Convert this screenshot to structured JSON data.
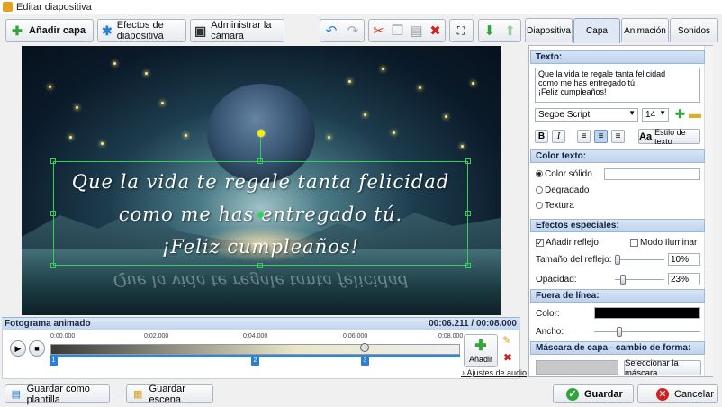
{
  "window": {
    "title": "Editar diapositiva"
  },
  "toolbar": {
    "add_layer": "Añadir capa",
    "slide_effects": "Efectos de diapositiva",
    "manage_camera": "Administrar la cámara"
  },
  "canvas": {
    "caption_lines": [
      "Que la vida te regale tanta felicidad",
      "como me has entregado tú.",
      "¡Feliz cumpleaños!"
    ],
    "reflection": "Que la vida te regale tanta felicidad"
  },
  "timeline": {
    "title": "Fotograma animado",
    "time_display": "00:06.211 / 00:08.000",
    "ticks": [
      "0:00.000",
      "0:02.000",
      "0:04.000",
      "0:06.000",
      "0:08.000"
    ],
    "markers": [
      "1",
      "2",
      "3"
    ],
    "add_label": "Añadir",
    "audio_link": "Ajustes de audio"
  },
  "bottom": {
    "save_template": "Guardar como plantilla",
    "save_scene": "Guardar escena",
    "save": "Guardar",
    "cancel": "Cancelar"
  },
  "tabs": [
    "Diapositiva",
    "Capa",
    "Animación",
    "Sonidos"
  ],
  "panel": {
    "text_section": "Texto:",
    "text_lines": [
      "Que la vida te regale tanta felicidad",
      "como me has entregado tú.",
      "¡Feliz cumpleaños!"
    ],
    "font": "Segoe Script",
    "size": "14",
    "bold": "B",
    "italic": "I",
    "text_style": "Estilo de texto",
    "color_section": "Color texto:",
    "solid": "Color sólido",
    "gradient": "Degradado",
    "texture": "Textura",
    "effects_section": "Efectos especiales:",
    "add_reflection": "Añadir reflejo",
    "illuminate": "Modo Iluminar",
    "reflect_size_label": "Tamaño del reflejo:",
    "reflect_size": "10%",
    "opacity_label": "Opacidad:",
    "opacity": "23%",
    "outline_section": "Fuera de línea:",
    "color_label": "Color:",
    "width_label": "Ancho:",
    "mask_section": "Máscara de capa - cambio de forma:",
    "mask_button": "Seleccionar la máscara"
  },
  "colors": {
    "accent": "#32d05a",
    "selection": "#2a7fd0"
  }
}
